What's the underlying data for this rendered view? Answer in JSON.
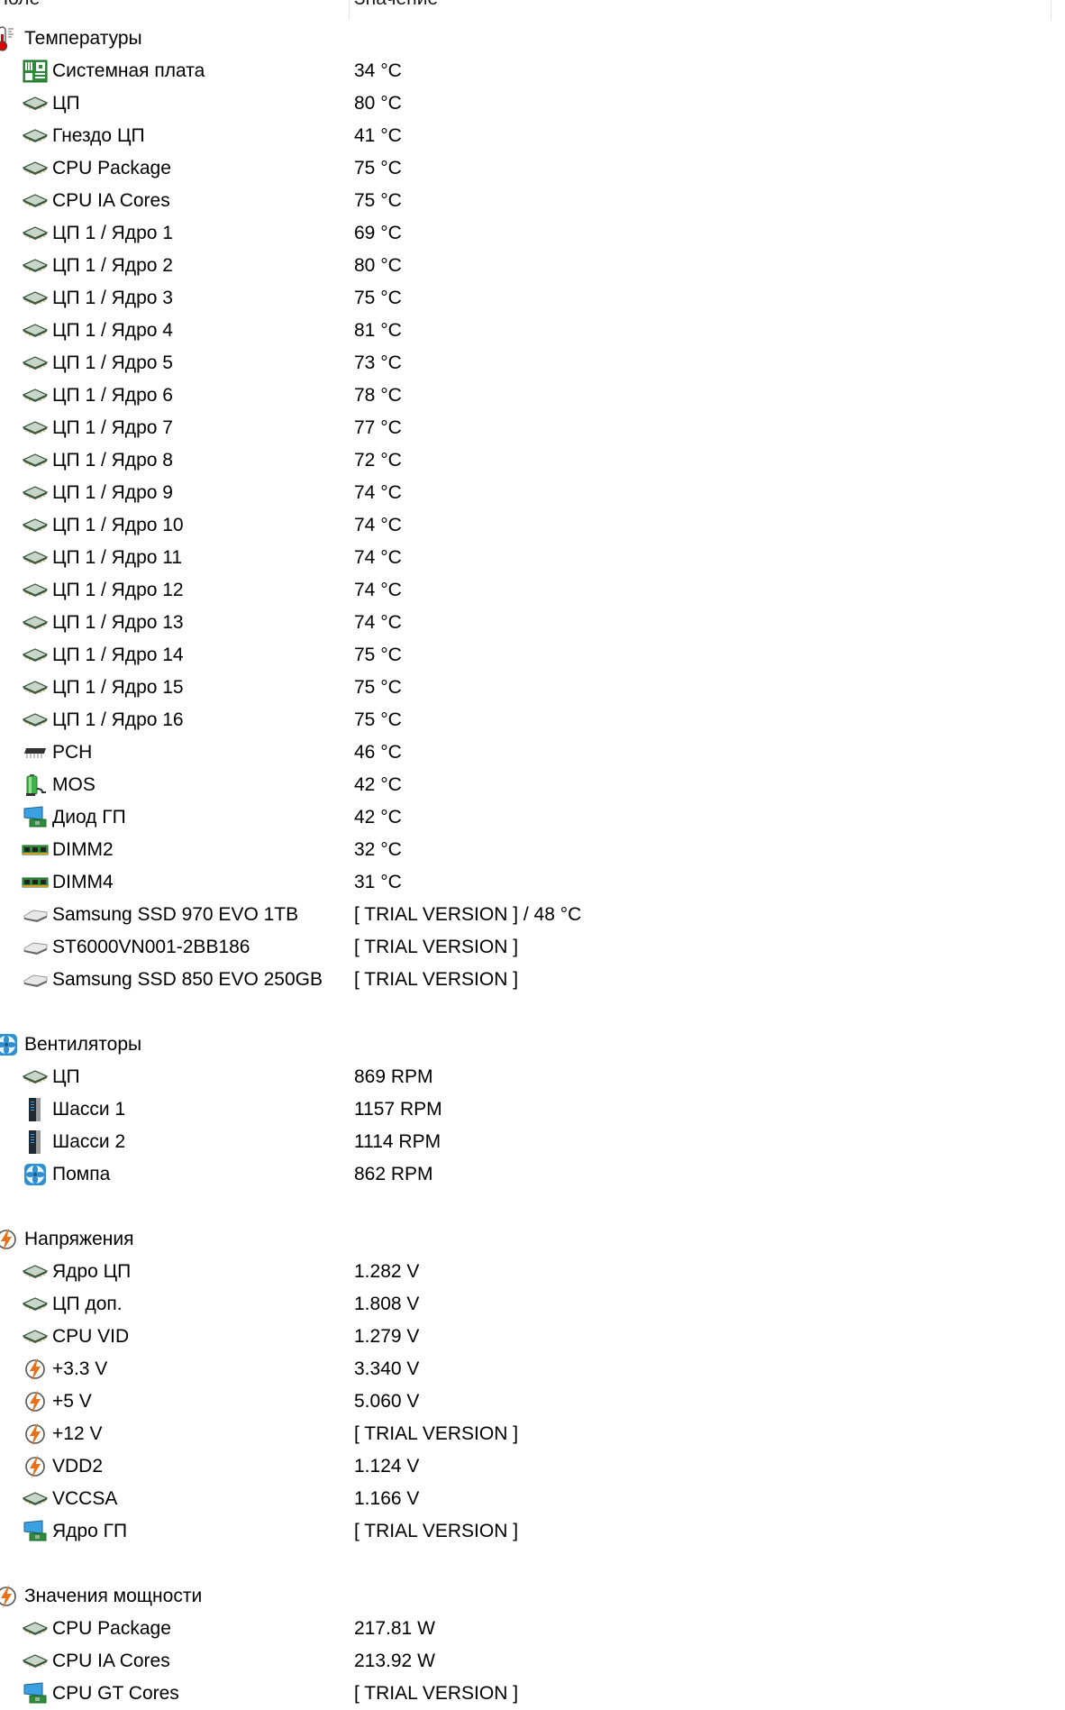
{
  "header": {
    "field_label": "Поле",
    "value_label": "Значение"
  },
  "groups": [
    {
      "title": "Температуры",
      "icon": "thermometer-icon",
      "items": [
        {
          "label": "Системная плата",
          "value": "34 °C",
          "icon": "motherboard-icon"
        },
        {
          "label": "ЦП",
          "value": "80 °C",
          "icon": "cpu-chip-icon"
        },
        {
          "label": "Гнездо ЦП",
          "value": "41 °C",
          "icon": "cpu-chip-icon"
        },
        {
          "label": "CPU Package",
          "value": "75 °C",
          "icon": "cpu-chip-icon"
        },
        {
          "label": "CPU IA Cores",
          "value": "75 °C",
          "icon": "cpu-chip-icon"
        },
        {
          "label": "ЦП 1 / Ядро 1",
          "value": "69 °C",
          "icon": "cpu-chip-icon"
        },
        {
          "label": "ЦП 1 / Ядро 2",
          "value": "80 °C",
          "icon": "cpu-chip-icon"
        },
        {
          "label": "ЦП 1 / Ядро 3",
          "value": "75 °C",
          "icon": "cpu-chip-icon"
        },
        {
          "label": "ЦП 1 / Ядро 4",
          "value": "81 °C",
          "icon": "cpu-chip-icon"
        },
        {
          "label": "ЦП 1 / Ядро 5",
          "value": "73 °C",
          "icon": "cpu-chip-icon"
        },
        {
          "label": "ЦП 1 / Ядро 6",
          "value": "78 °C",
          "icon": "cpu-chip-icon"
        },
        {
          "label": "ЦП 1 / Ядро 7",
          "value": "77 °C",
          "icon": "cpu-chip-icon"
        },
        {
          "label": "ЦП 1 / Ядро 8",
          "value": "72 °C",
          "icon": "cpu-chip-icon"
        },
        {
          "label": "ЦП 1 / Ядро 9",
          "value": "74 °C",
          "icon": "cpu-chip-icon"
        },
        {
          "label": "ЦП 1 / Ядро 10",
          "value": "74 °C",
          "icon": "cpu-chip-icon"
        },
        {
          "label": "ЦП 1 / Ядро 11",
          "value": "74 °C",
          "icon": "cpu-chip-icon"
        },
        {
          "label": "ЦП 1 / Ядро 12",
          "value": "74 °C",
          "icon": "cpu-chip-icon"
        },
        {
          "label": "ЦП 1 / Ядро 13",
          "value": "74 °C",
          "icon": "cpu-chip-icon"
        },
        {
          "label": "ЦП 1 / Ядро 14",
          "value": "75 °C",
          "icon": "cpu-chip-icon"
        },
        {
          "label": "ЦП 1 / Ядро 15",
          "value": "75 °C",
          "icon": "cpu-chip-icon"
        },
        {
          "label": "ЦП 1 / Ядро 16",
          "value": "75 °C",
          "icon": "cpu-chip-icon"
        },
        {
          "label": "PCH",
          "value": "46 °C",
          "icon": "chipset-icon"
        },
        {
          "label": "MOS",
          "value": "42 °C",
          "icon": "battery-plug-icon"
        },
        {
          "label": "Диод ГП",
          "value": "42 °C",
          "icon": "gpu-card-icon"
        },
        {
          "label": "DIMM2",
          "value": "32 °C",
          "icon": "memory-module-icon"
        },
        {
          "label": "DIMM4",
          "value": "31 °C",
          "icon": "memory-module-icon"
        },
        {
          "label": "Samsung SSD 970 EVO 1TB",
          "value": "[ TRIAL VERSION ] / 48 °C",
          "icon": "hard-drive-icon"
        },
        {
          "label": "ST6000VN001-2BB186",
          "value": "[ TRIAL VERSION ]",
          "icon": "hard-drive-icon"
        },
        {
          "label": "Samsung SSD 850 EVO 250GB",
          "value": "[ TRIAL VERSION ]",
          "icon": "hard-drive-icon"
        }
      ]
    },
    {
      "title": "Вентиляторы",
      "icon": "fan-icon",
      "items": [
        {
          "label": "ЦП",
          "value": "869 RPM",
          "icon": "cpu-chip-icon"
        },
        {
          "label": "Шасси 1",
          "value": "1157 RPM",
          "icon": "chassis-icon"
        },
        {
          "label": "Шасси 2",
          "value": "1114 RPM",
          "icon": "chassis-icon"
        },
        {
          "label": "Помпа",
          "value": "862 RPM",
          "icon": "fan-icon"
        }
      ]
    },
    {
      "title": "Напряжения",
      "icon": "lightning-icon",
      "items": [
        {
          "label": "Ядро ЦП",
          "value": "1.282 V",
          "icon": "cpu-chip-icon"
        },
        {
          "label": "ЦП доп.",
          "value": "1.808 V",
          "icon": "cpu-chip-icon"
        },
        {
          "label": "CPU VID",
          "value": "1.279 V",
          "icon": "cpu-chip-icon"
        },
        {
          "label": "+3.3 V",
          "value": "3.340 V",
          "icon": "lightning-icon"
        },
        {
          "label": "+5 V",
          "value": "5.060 V",
          "icon": "lightning-icon"
        },
        {
          "label": "+12 V",
          "value": "[ TRIAL VERSION ]",
          "icon": "lightning-icon"
        },
        {
          "label": "VDD2",
          "value": "1.124 V",
          "icon": "lightning-icon"
        },
        {
          "label": "VCCSA",
          "value": "1.166 V",
          "icon": "cpu-chip-icon"
        },
        {
          "label": "Ядро ГП",
          "value": "[ TRIAL VERSION ]",
          "icon": "gpu-card-icon"
        }
      ]
    },
    {
      "title": "Значения мощности",
      "icon": "lightning-icon",
      "items": [
        {
          "label": "CPU Package",
          "value": "217.81 W",
          "icon": "cpu-chip-icon"
        },
        {
          "label": "CPU IA Cores",
          "value": "213.92 W",
          "icon": "cpu-chip-icon"
        },
        {
          "label": "CPU GT Cores",
          "value": "[ TRIAL VERSION ]",
          "icon": "gpu-card-icon"
        }
      ]
    }
  ]
}
